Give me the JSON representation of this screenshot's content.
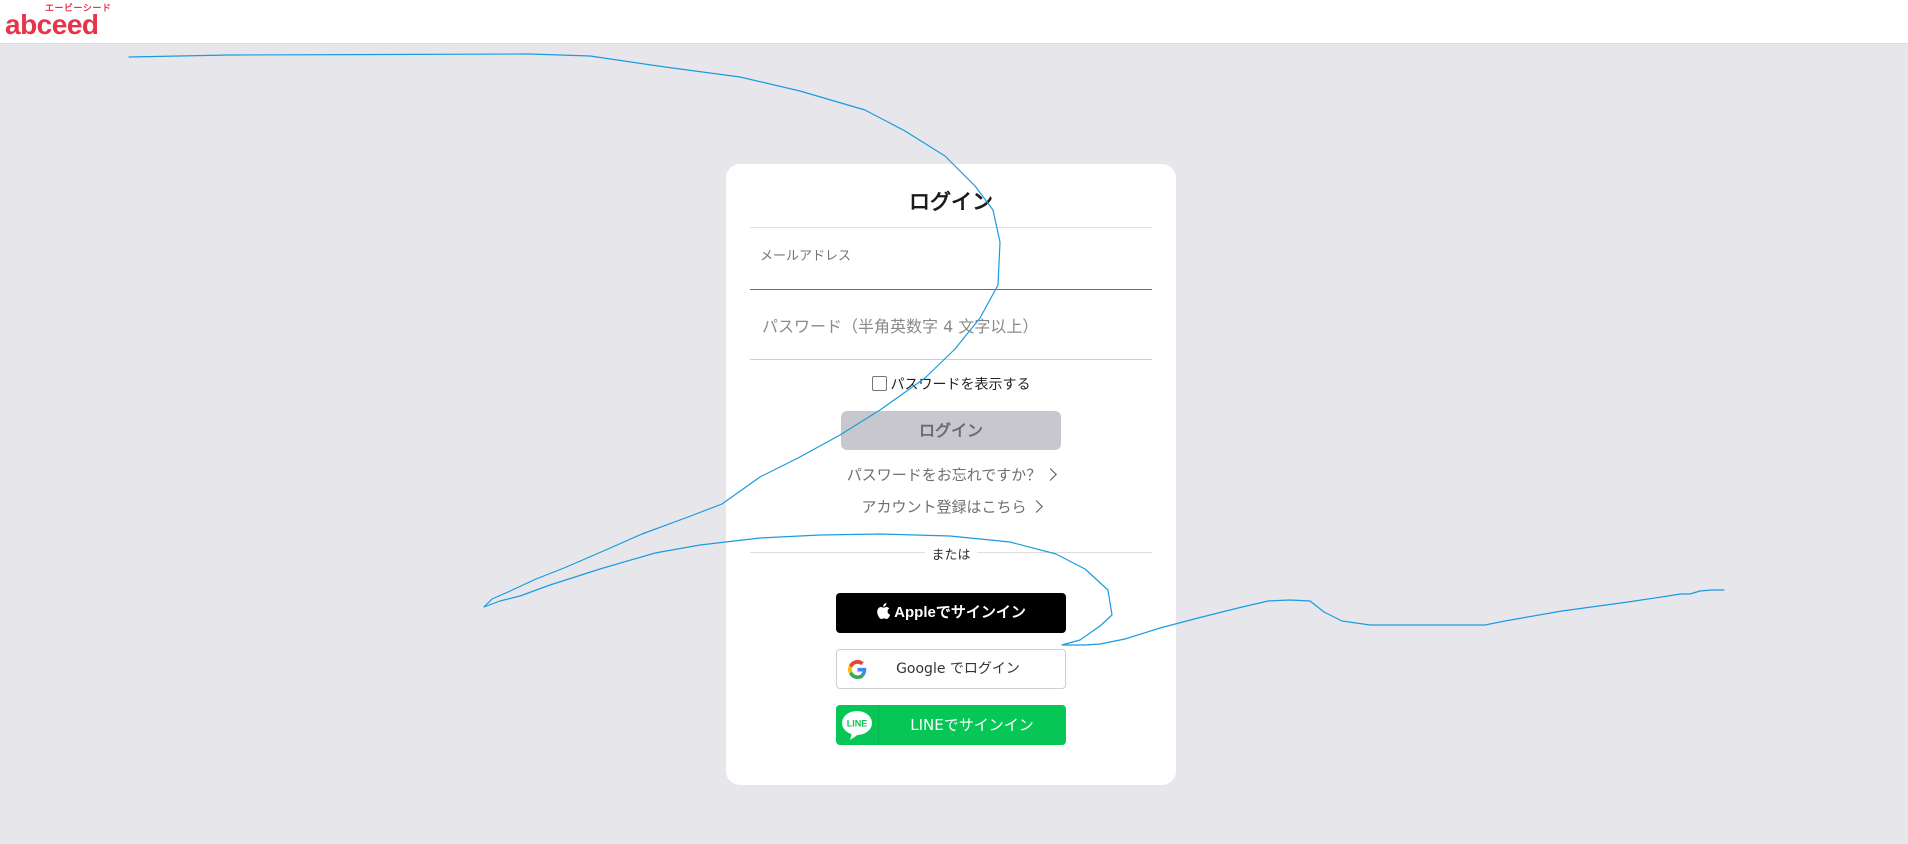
{
  "header": {
    "logo_sub": "エービーシード",
    "logo_main": "abceed"
  },
  "login": {
    "title": "ログイン",
    "email_label": "メールアドレス",
    "email_value": "",
    "password_placeholder": "パスワード（半角英数字 4 文字以上）",
    "password_value": "",
    "show_password_label": "パスワードを表示する",
    "show_password_checked": false,
    "submit_label": "ログイン",
    "forgot_link": "パスワードをお忘れですか？",
    "register_link": "アカウント登録はこちら",
    "divider_label": "または"
  },
  "social": {
    "apple_label": "Appleでサインイン",
    "google_label": "Google でログイン",
    "line_label": "LINEでサインイン",
    "line_icon_text": "LINE"
  },
  "colors": {
    "brand": "#e8344a",
    "line_green": "#06c755",
    "submit_disabled": "#c7c7cd",
    "page_bg": "#e7e7eb",
    "scribble": "#1a9be0"
  },
  "icons": [
    "apple-icon",
    "google-icon",
    "line-icon",
    "chevron-right-icon"
  ]
}
